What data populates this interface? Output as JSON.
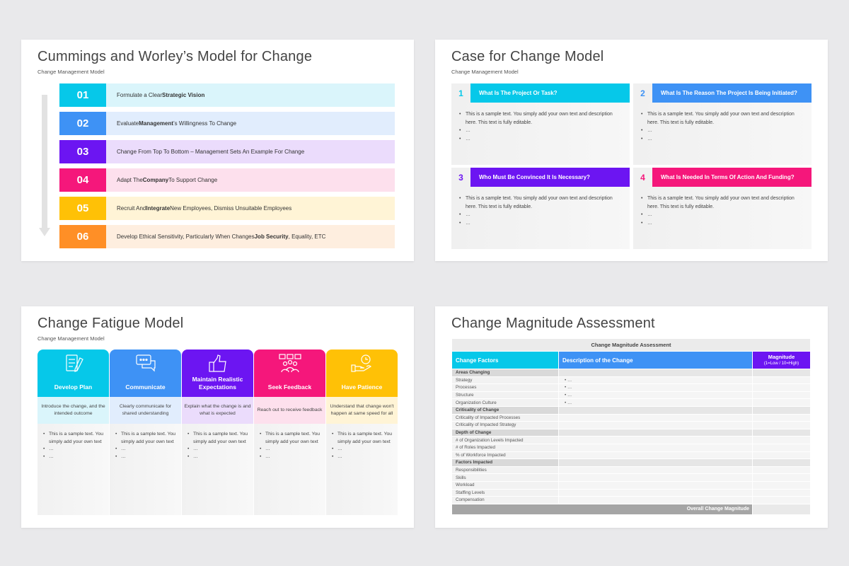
{
  "slides": {
    "cummings": {
      "title": "Cummings and Worley’s Model for Change",
      "subtitle": "Change Management Model",
      "steps": [
        {
          "num": "01",
          "color": "#06c8e9",
          "bg": "#daf5fb",
          "pre": "Formulate a Clear ",
          "bold": "Strategic Vision",
          "post": ""
        },
        {
          "num": "02",
          "color": "#3e92f5",
          "bg": "#e1edfd",
          "pre": "Evaluate ",
          "bold": "Management",
          "post": "’s Willingness To Change"
        },
        {
          "num": "03",
          "color": "#6c15f2",
          "bg": "#ebdcfc",
          "pre": "Change From Top To Bottom – Management Sets An Example For Change",
          "bold": "",
          "post": ""
        },
        {
          "num": "04",
          "color": "#f5177b",
          "bg": "#fde0ed",
          "pre": "Adapt The ",
          "bold": "Company",
          "post": " To Support Change"
        },
        {
          "num": "05",
          "color": "#ffc106",
          "bg": "#fff4d6",
          "pre": "Recruit And ",
          "bold": "Integrate",
          "post": " New Employees, Dismiss Unsuitable Employees"
        },
        {
          "num": "06",
          "color": "#ff8f26",
          "bg": "#feeedf",
          "pre": "Develop Ethical Sensitivity, Particularly When Changes ",
          "bold": "Job Security",
          "post": ", Equality, ETC"
        }
      ]
    },
    "case": {
      "title": "Case for Change Model",
      "subtitle": "Change Management Model",
      "boxes": [
        {
          "num": "1",
          "color": "#06c8e9",
          "heading": "What Is The Project Or Task?",
          "bullets": [
            "This is a sample text. You simply add your own text and description here. This text is fully editable.",
            "…",
            "…"
          ]
        },
        {
          "num": "2",
          "color": "#3e92f5",
          "heading": "What Is The Reason The Project Is Being Initiated?",
          "bullets": [
            "This is a sample text. You simply add your own text and description here. This text is fully editable.",
            "…",
            "…"
          ]
        },
        {
          "num": "3",
          "color": "#6c15f2",
          "heading": "Who Must Be Convinced It Is Necessary?",
          "bullets": [
            "This is a sample text. You simply add your own text and description here. This text is fully editable.",
            "…",
            "…"
          ]
        },
        {
          "num": "4",
          "color": "#f5177b",
          "heading": "What Is Needed In Terms Of Action And Funding?",
          "bullets": [
            "This is a sample text. You simply add your own text and description here. This text is fully editable.",
            "…",
            "…"
          ]
        }
      ]
    },
    "fatigue": {
      "title": "Change Fatigue Model",
      "subtitle": "Change Management Model",
      "columns": [
        {
          "icon": "checklist-pen-icon",
          "color": "#06c8e9",
          "descBg": "#daf5fb",
          "title": "Develop Plan",
          "desc": "Introduce the change, and the intended outcome",
          "bullets": [
            "This is a sample text. You simply add your own text",
            "…",
            "…"
          ]
        },
        {
          "icon": "chat-bubbles-icon",
          "color": "#3e92f5",
          "descBg": "#e1edfd",
          "title": "Communicate",
          "desc": "Clearly communicate for shared understanding",
          "bullets": [
            "This is a sample text. You simply add your own text",
            "…",
            "…"
          ]
        },
        {
          "icon": "thumbs-up-icon",
          "color": "#6c15f2",
          "descBg": "#ebdcfc",
          "title": "Maintain Realistic Expectations",
          "desc": "Explain what the change is and what is expected",
          "bullets": [
            "This is a sample text. You simply add your own text",
            "…",
            "…"
          ]
        },
        {
          "icon": "group-feedback-icon",
          "color": "#f5177b",
          "descBg": "#fde0ed",
          "title": "Seek Feedback",
          "desc": "Reach out to receive feedback",
          "bullets": [
            "This is a sample text. You simply add your own text",
            "…",
            "…"
          ]
        },
        {
          "icon": "hand-clock-icon",
          "color": "#ffc106",
          "descBg": "#fff4d6",
          "title": "Have Patience",
          "desc": "Understand that change won't happen at same speed for all",
          "bullets": [
            "This is a sample text. You simply add your own text",
            "…",
            "…"
          ]
        }
      ]
    },
    "magnitude": {
      "title": "Change Magnitude Assessment",
      "table": {
        "caption": "Change Magnitude Assessment",
        "headers": {
          "factors": "Change Factors",
          "description": "Description of the Change",
          "magnitude": "Magnitude",
          "magnitude_note": "(1=Low / 10=High)"
        },
        "rows": [
          {
            "type": "section",
            "label": "Areas Changing"
          },
          {
            "type": "row",
            "label": "Strategy",
            "desc": "…"
          },
          {
            "type": "row",
            "label": "Processes",
            "desc": "…"
          },
          {
            "type": "row",
            "label": "Structure",
            "desc": "…"
          },
          {
            "type": "row",
            "label": "Organization Culture",
            "desc": "…"
          },
          {
            "type": "section",
            "label": "Criticality of Change"
          },
          {
            "type": "row",
            "label": "Criticality of Impacted Processes",
            "desc": ""
          },
          {
            "type": "row",
            "label": "Criticality of Impacted Strategy",
            "desc": ""
          },
          {
            "type": "section",
            "label": "Depth of Change"
          },
          {
            "type": "row",
            "label": "# of Organization Levels Impacted",
            "desc": ""
          },
          {
            "type": "row",
            "label": "# of Roles Impacted",
            "desc": ""
          },
          {
            "type": "row",
            "label": "% of Workforce Impacted",
            "desc": ""
          },
          {
            "type": "section",
            "label": "Factors Impacted"
          },
          {
            "type": "row",
            "label": "Responsibilities",
            "desc": ""
          },
          {
            "type": "row",
            "label": "Skills",
            "desc": ""
          },
          {
            "type": "row",
            "label": "Workload",
            "desc": ""
          },
          {
            "type": "row",
            "label": "Staffing Levels",
            "desc": ""
          },
          {
            "type": "row",
            "label": "Compensation",
            "desc": ""
          }
        ],
        "footer": "Overall Change Magnitude"
      }
    }
  }
}
